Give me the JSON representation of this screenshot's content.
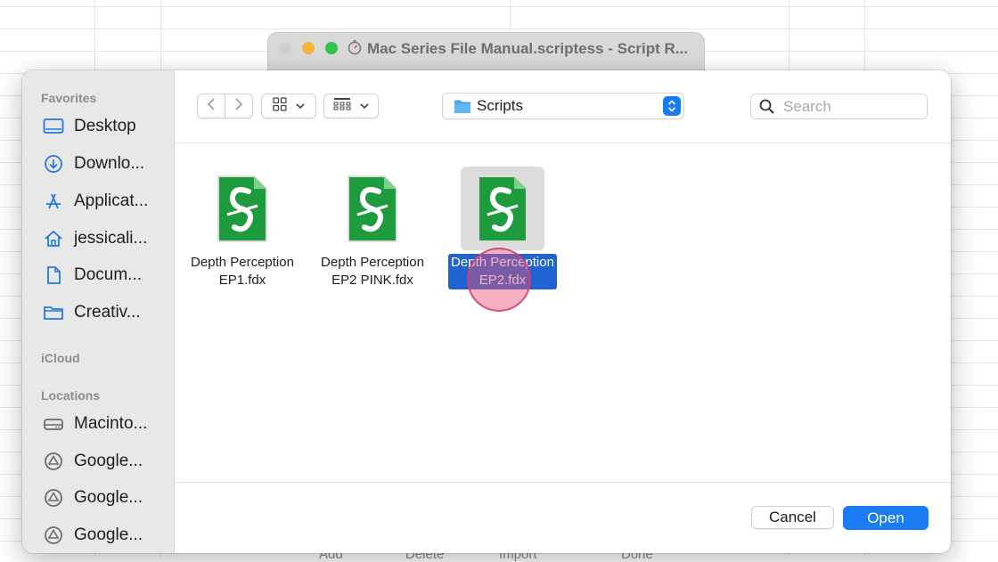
{
  "parent_window": {
    "title": "Mac Series File Manual.scriptess - Script R...",
    "bottom_buttons": [
      "Add",
      "Delete",
      "Import",
      "Done"
    ]
  },
  "sidebar": {
    "favorites_header": "Favorites",
    "favorites": [
      {
        "label": "Desktop",
        "icon": "desktop-icon"
      },
      {
        "label": "Downlo...",
        "icon": "download-icon"
      },
      {
        "label": "Applicat...",
        "icon": "applications-icon"
      },
      {
        "label": "jessicali...",
        "icon": "home-icon"
      },
      {
        "label": "Docum...",
        "icon": "document-icon"
      },
      {
        "label": "Creativ...",
        "icon": "folder-icon"
      }
    ],
    "icloud_header": "iCloud",
    "locations_header": "Locations",
    "locations": [
      {
        "label": "Macinto...",
        "icon": "hard-drive-icon"
      },
      {
        "label": "Google...",
        "icon": "google-drive-icon"
      },
      {
        "label": "Google...",
        "icon": "google-drive-icon"
      },
      {
        "label": "Google...",
        "icon": "google-drive-icon"
      }
    ]
  },
  "toolbar": {
    "folder": "Scripts",
    "search_placeholder": "Search"
  },
  "files": [
    {
      "line1": "Depth Perception",
      "line2": "EP1.fdx",
      "selected": false
    },
    {
      "line1": "Depth Perception",
      "line2": "EP2 PINK.fdx",
      "selected": false
    },
    {
      "line1": "Depth Perception",
      "line2": "EP2.fdx",
      "selected": true
    }
  ],
  "footer": {
    "cancel_label": "Cancel",
    "open_label": "Open"
  },
  "colors": {
    "accent": "#1a7cf5",
    "selection": "#1f64d2",
    "fdx_green": "#1e9b3c"
  }
}
